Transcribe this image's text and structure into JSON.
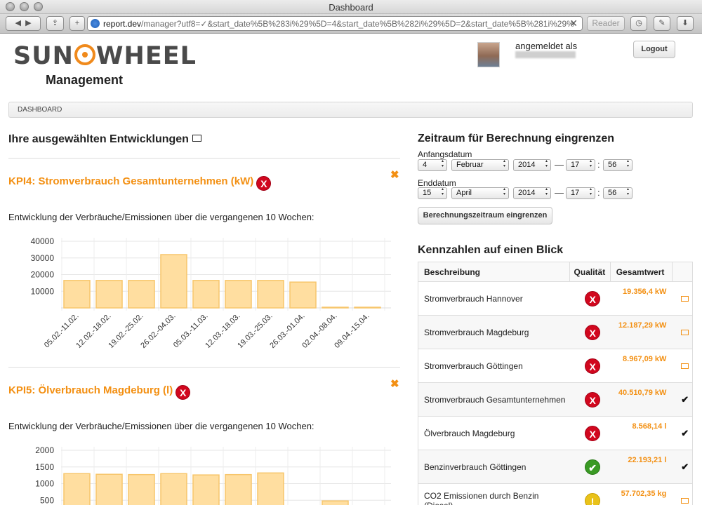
{
  "window": {
    "title": "Dashboard"
  },
  "toolbar": {
    "url_host": "report.dev",
    "url_rest": "/manager?utf8=✓&start_date%5B%283i%29%5D=4&start_date%5B%282i%29%5D=2&start_date%5B%281i%29%",
    "reader_label": "Reader"
  },
  "header": {
    "logo_left": "SUN",
    "logo_right": "WHEEL",
    "subtitle": "Management",
    "logged_in_label": "angemeldet als",
    "logout_label": "Logout"
  },
  "breadcrumb": {
    "item": "DASHBOARD"
  },
  "left": {
    "title": "Ihre ausgewählten Entwicklungen",
    "kpis": [
      {
        "title": "KPI4: Stromverbrauch Gesamtunternehmen (kW)",
        "subtitle": "Entwicklung der Verbräuche/Emissionen über die vergangenen 10 Wochen:",
        "close": "✖"
      },
      {
        "title": "KPI5: Ölverbrauch Magdeburg (l)",
        "subtitle": "Entwicklung der Verbräuche/Emissionen über die vergangenen 10 Wochen:",
        "close": "✖"
      }
    ]
  },
  "chart_data": [
    {
      "type": "bar",
      "categories": [
        "05.02.-11.02.",
        "12.02.-18.02.",
        "19.02.-25.02.",
        "26.02.-04.03.",
        "05.03.-11.03.",
        "12.03.-18.03.",
        "19.03.-25.03.",
        "26.03.-01.04.",
        "02.04.-08.04.",
        "09.04.-15.04."
      ],
      "values": [
        16500,
        16500,
        16500,
        32000,
        16500,
        16500,
        16500,
        15500,
        0,
        0
      ],
      "yticks": [
        10000,
        20000,
        30000,
        40000
      ],
      "ylim": [
        0,
        40000
      ],
      "grid": true,
      "bar_color": "#ffdea0",
      "bar_stroke": "#f7c66c"
    },
    {
      "type": "bar",
      "categories": [],
      "values": [
        1300,
        1280,
        1270,
        1300,
        1260,
        1270,
        1320,
        0,
        480
      ],
      "yticks": [
        500,
        1000,
        1500,
        2000
      ],
      "ylim": [
        0,
        2000
      ],
      "grid": true,
      "bar_color": "#ffdea0",
      "bar_stroke": "#f7c66c"
    }
  ],
  "right": {
    "range_title": "Zeitraum für Berechnung eingrenzen",
    "start_label": "Anfangsdatum",
    "start": {
      "day": "4",
      "month": "Februar",
      "year": "2014",
      "hour": "17",
      "minute": "56"
    },
    "end_label": "Enddatum",
    "end": {
      "day": "15",
      "month": "April",
      "year": "2014",
      "hour": "17",
      "minute": "56"
    },
    "dash": "—",
    "colon": ":",
    "calc_button": "Berechnungszeitraum eingrenzen",
    "kz_title": "Kennzahlen auf einen Blick",
    "table_headers": [
      "Beschreibung",
      "Qualität",
      "Gesamtwert",
      ""
    ],
    "rows": [
      {
        "desc": "Stromverbrauch Hannover",
        "quality": "bad",
        "value": "19.356,4 kW",
        "action": "chart"
      },
      {
        "desc": "Stromverbrauch Magdeburg",
        "quality": "bad",
        "value": "12.187,29 kW",
        "action": "chart"
      },
      {
        "desc": "Stromverbrauch Göttingen",
        "quality": "bad",
        "value": "8.967,09 kW",
        "action": "chart"
      },
      {
        "desc": "Stromverbrauch Gesamtunternehmen",
        "quality": "bad",
        "value": "40.510,79 kW",
        "action": "check"
      },
      {
        "desc": "Ölverbrauch Magdeburg",
        "quality": "bad",
        "value": "8.568,14 l",
        "action": "check"
      },
      {
        "desc": "Benzinverbrauch Göttingen",
        "quality": "good",
        "value": "22.193,21 l",
        "action": "check"
      },
      {
        "desc": "CO2 Emissionen durch Benzin (Diesel)",
        "quality": "warn",
        "value": "57.702,35 kg",
        "action": "chart"
      }
    ],
    "quality_symbols": {
      "bad": "X",
      "good": "✔",
      "warn": "!"
    },
    "check_symbol": "✔"
  }
}
